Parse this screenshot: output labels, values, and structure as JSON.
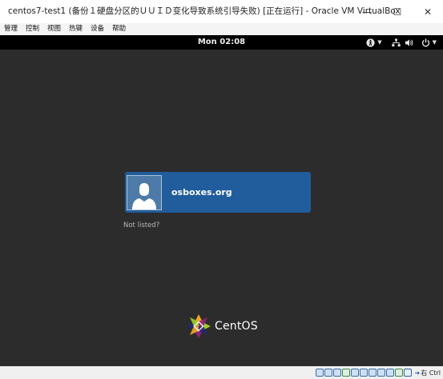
{
  "window": {
    "title": "centos7-test1 (备份１硬盘分区的ＵＵＩＤ变化导致系统引导失败) [正在运行] - Oracle VM VirtualBox",
    "minimize_glyph": "—",
    "maximize_glyph": "☐",
    "close_glyph": "✕"
  },
  "menubar": {
    "items": [
      "管理",
      "控制",
      "视图",
      "热键",
      "设备",
      "帮助"
    ]
  },
  "gnome": {
    "clock": "Mon 02:08",
    "user_name": "osboxes.org",
    "not_listed": "Not listed?",
    "logo_text": "CentOS"
  },
  "statusbar": {
    "host_key": "右 Ctrl"
  },
  "colors": {
    "vm_background": "#2c2c2c",
    "topbar": "#000000",
    "user_card": "#215d9c",
    "not_listed_text": "#b8b8b8"
  }
}
